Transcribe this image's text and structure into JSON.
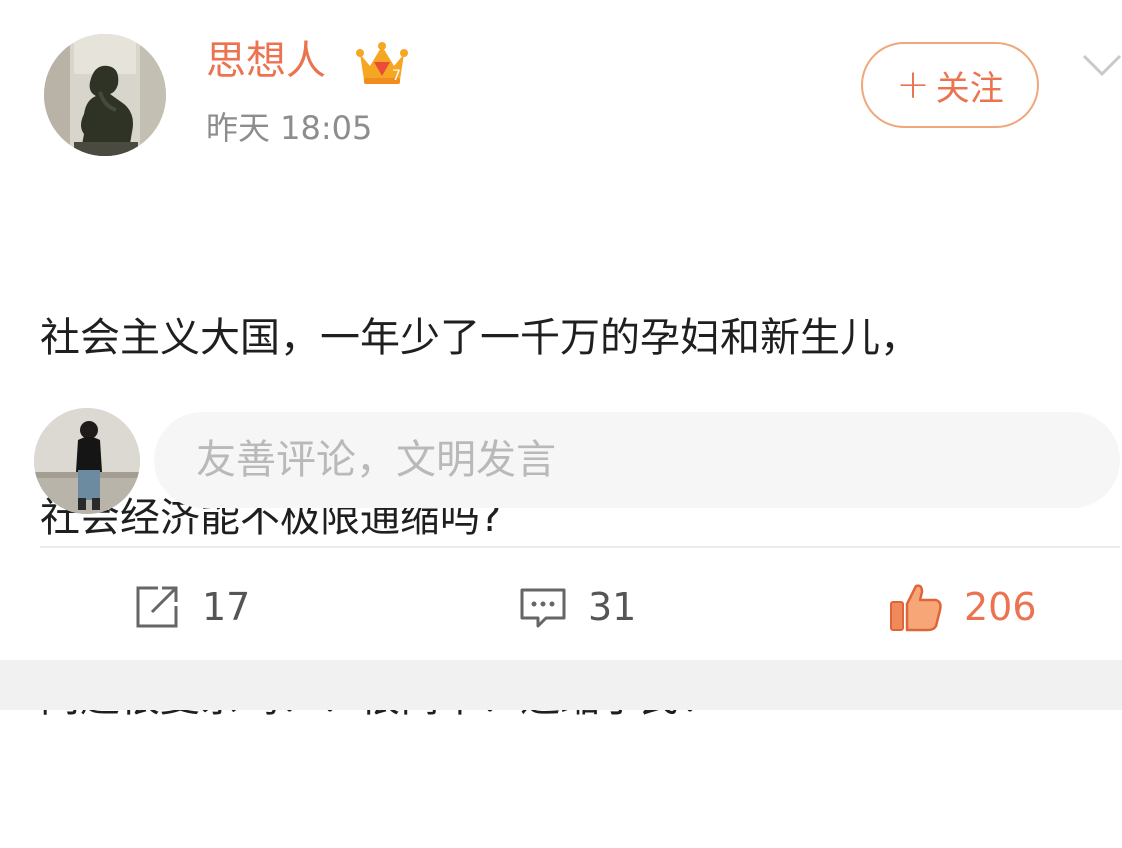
{
  "post": {
    "author": {
      "name": "思想人",
      "badge_icon": "vip-crown-icon",
      "avatar_icon": "thinker-statue-avatar"
    },
    "timestamp": "昨天 18:05",
    "follow_label": "关注",
    "follow_prefix": "+",
    "content_lines": [
      "社会主义大国，一年少了一千万的孕妇和新生儿，",
      "社会经济能不极限通缩吗?",
      "问题很复杂吗？！很简单！通缩于民！"
    ]
  },
  "comment": {
    "placeholder": "友善评论，文明发言"
  },
  "actions": {
    "repost_count": "17",
    "comment_count": "31",
    "like_count": "206"
  },
  "colors": {
    "accent": "#eb7350",
    "follow_border": "#f0a77c",
    "timestamp": "#8d8d8d",
    "placeholder": "#b9b9b9"
  }
}
